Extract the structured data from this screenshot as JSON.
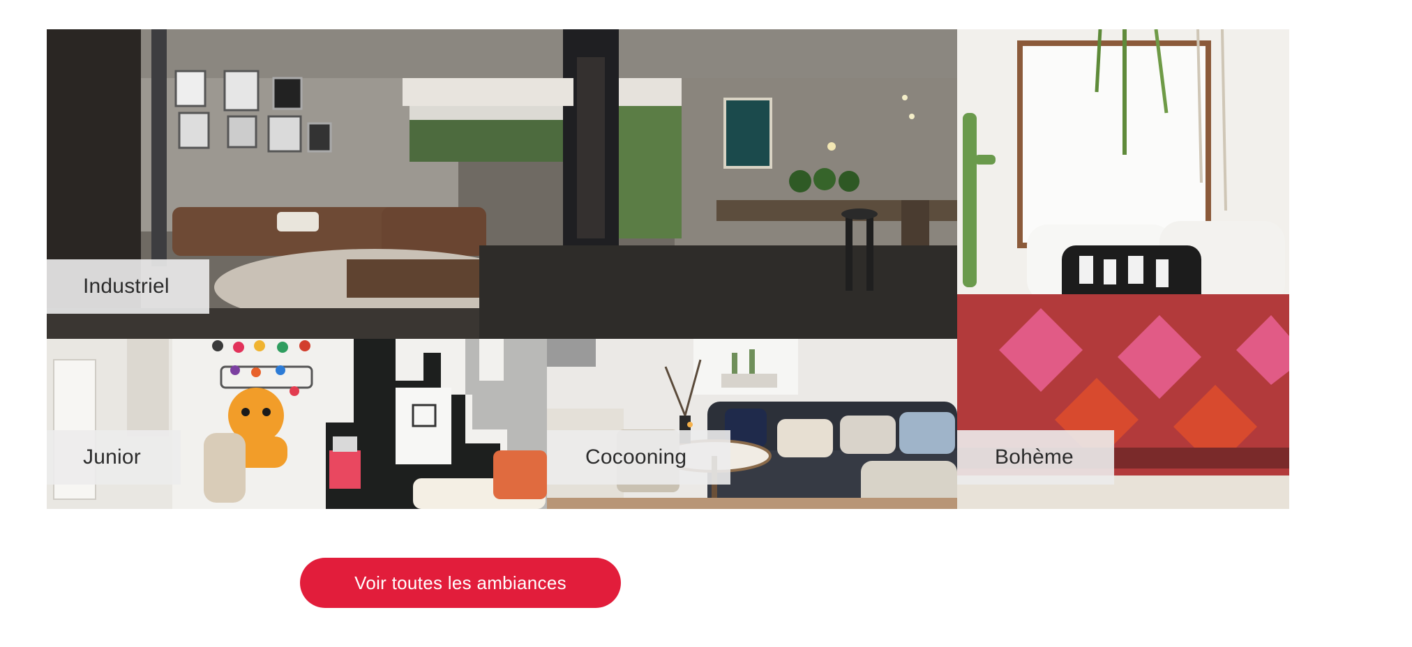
{
  "gallery": {
    "tiles": [
      {
        "label": "Industriel",
        "image": "industrial-living-room-photo"
      },
      {
        "label": "Junior",
        "image": "kids-bedroom-photo"
      },
      {
        "label": "Cocooning",
        "image": "cozy-living-room-photo"
      },
      {
        "label": "Bohème",
        "image": "bohemian-bedroom-photo"
      }
    ]
  },
  "cta": {
    "label": "Voir toutes les ambiances"
  },
  "colors": {
    "accent": "#e21d3b",
    "label_background": "#ececec",
    "label_text": "#2b2b2b",
    "page_background": "#ffffff"
  }
}
